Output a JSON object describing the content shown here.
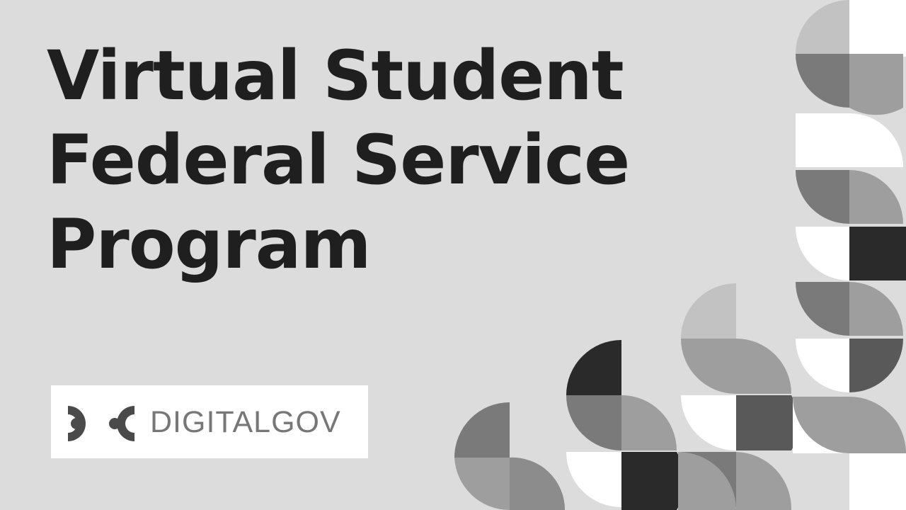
{
  "title": {
    "line1": "Virtual Student",
    "line2": "Federal Service",
    "line3": "Program"
  },
  "logo": {
    "text": "DIGITALGOV",
    "icon": "digitalgov-logo-mark"
  },
  "colors": {
    "background": "#dcdcdc",
    "title": "#1f1f1f",
    "logo_text": "#777777",
    "logo_mark": "#4a4a4a",
    "pattern_shades": [
      "#ffffff",
      "#c2c2c2",
      "#9e9e9e",
      "#7a7a7a",
      "#595959",
      "#2a2a2a"
    ]
  },
  "decoration": "geometric-quarter-circle-pattern"
}
